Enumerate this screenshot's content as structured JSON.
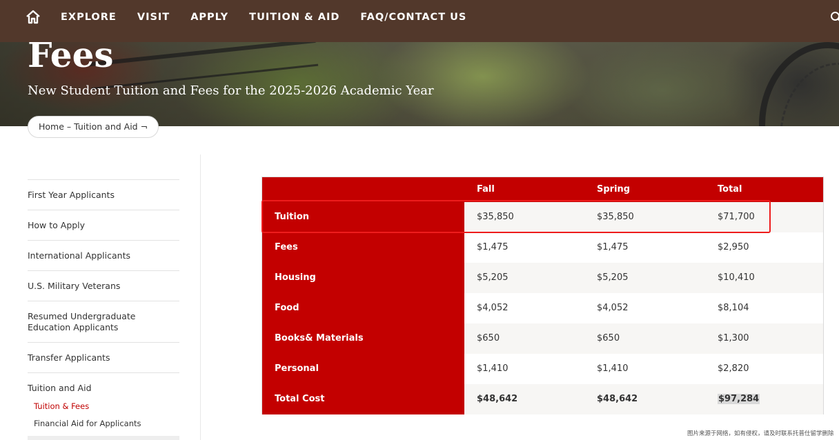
{
  "nav": {
    "home_icon": "home-icon",
    "links": [
      "EXPLORE",
      "VISIT",
      "APPLY",
      "TUITION & AID",
      "FAQ/CONTACT US"
    ],
    "search_icon": "search-icon",
    "bg_color": "#52382b"
  },
  "hero": {
    "title": "Fees",
    "subtitle": "New Student Tuition and Fees for the 2025-2026 Academic Year"
  },
  "breadcrumb": "Home – Tuition and Aid ¬",
  "sidebar": {
    "items": [
      "First Year Applicants",
      "How to Apply",
      "International Applicants",
      "U.S. Military Veterans",
      "Resumed Undergraduate Education Applicants",
      "Transfer Applicants",
      "Tuition and Aid"
    ],
    "subitems": [
      {
        "label": "Tuition & Fees",
        "active": true
      },
      {
        "label": "Financial Aid for Applicants",
        "active": false
      }
    ],
    "active_color": "#c00000"
  },
  "table": {
    "accent_color": "#c30000",
    "headers": [
      "",
      "Fall",
      "Spring",
      "Total"
    ],
    "rows": [
      {
        "label": "Tuition",
        "fall": "$35,850",
        "spring": "$35,850",
        "total": "$71,700"
      },
      {
        "label": "Fees",
        "fall": "$1,475",
        "spring": "$1,475",
        "total": "$2,950"
      },
      {
        "label": "Housing",
        "fall": "$5,205",
        "spring": "$5,205",
        "total": "$10,410"
      },
      {
        "label": "Food",
        "fall": "$4,052",
        "spring": "$4,052",
        "total": "$8,104"
      },
      {
        "label": "Books& Materials",
        "fall": "$650",
        "spring": "$650",
        "total": "$1,300"
      },
      {
        "label": "Personal",
        "fall": "$1,410",
        "spring": "$1,410",
        "total": "$2,820"
      },
      {
        "label": "Total Cost",
        "fall": "$48,642",
        "spring": "$48,642",
        "total": "$97,284"
      }
    ],
    "highlight_color": "#ee1c1c"
  },
  "watermark": "图片来源于网络，如有侵权，请及时联系托普仕留学删除"
}
